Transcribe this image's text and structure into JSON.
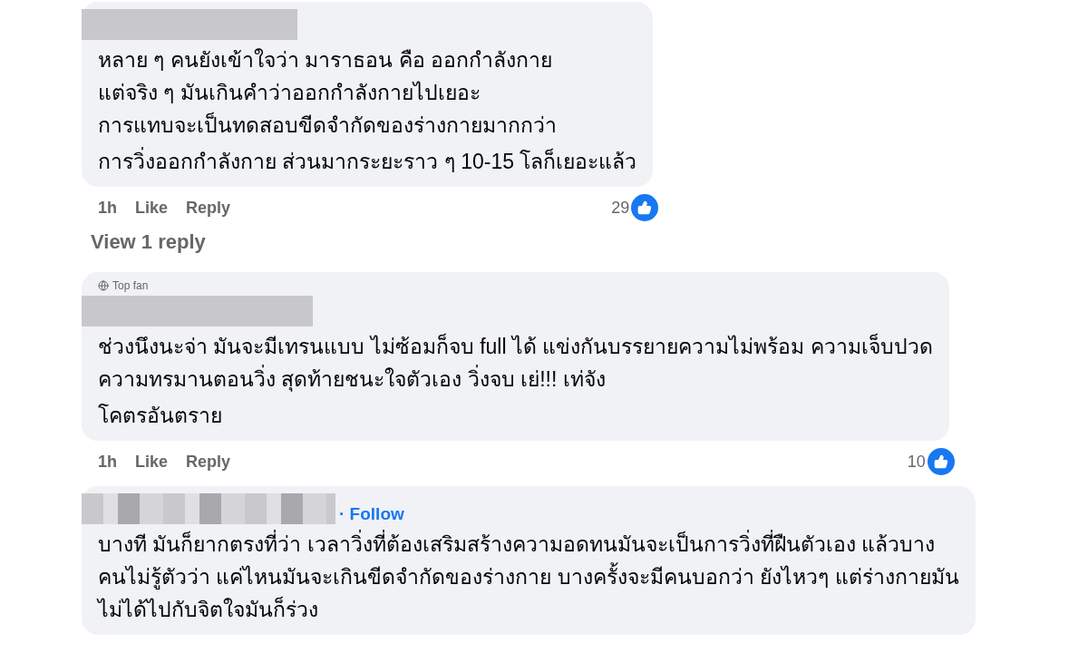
{
  "comments": [
    {
      "paragraphs": [
        "หลาย ๆ คนยังเข้าใจว่า มาราธอน คือ ออกกำลังกาย\nแต่จริง ๆ มันเกินคำว่าออกกำลังกายไปเยอะ\nการแทบจะเป็นทดสอบขีดจำกัดของร่างกายมากกว่า",
        "การวิ่งออกกำลังกาย ส่วนมากระยะราว ๆ 10-15 โลก็เยอะแล้ว"
      ],
      "time": "1h",
      "like": "Like",
      "reply": "Reply",
      "reactions": "29",
      "view_replies": "View 1 reply"
    },
    {
      "badge": "Top fan",
      "paragraphs": [
        "ช่วงนึงนะจ่า มันจะมีเทรนแบบ ไม่ซ้อมก็จบ full ได้ แข่งกันบรรยายความไม่พร้อม ความเจ็บปวด\nความทรมานตอนวิ่ง สุดท้ายชนะใจตัวเอง วิ่งจบ เย่!!! เท่จัง",
        "โคตรอันตราย"
      ],
      "time": "1h",
      "like": "Like",
      "reply": "Reply",
      "reactions": "10"
    },
    {
      "follow": "· Follow",
      "paragraphs": [
        "บางที มันก็ยากตรงที่ว่า เวลาวิ่งที่ต้องเสริมสร้างความอดทนมันจะเป็นการวิ่งที่ฝืนตัวเอง แล้วบาง\nคนไม่รู้ตัวว่า แค่ไหนมันจะเกินขีดจำกัดของร่างกาย บางครั้งจะมีคนบอกว่า ยังไหวๆ แต่ร่างกายมัน\nไม่ได้ไปกับจิตใจมันก็ร่วง"
      ]
    }
  ]
}
